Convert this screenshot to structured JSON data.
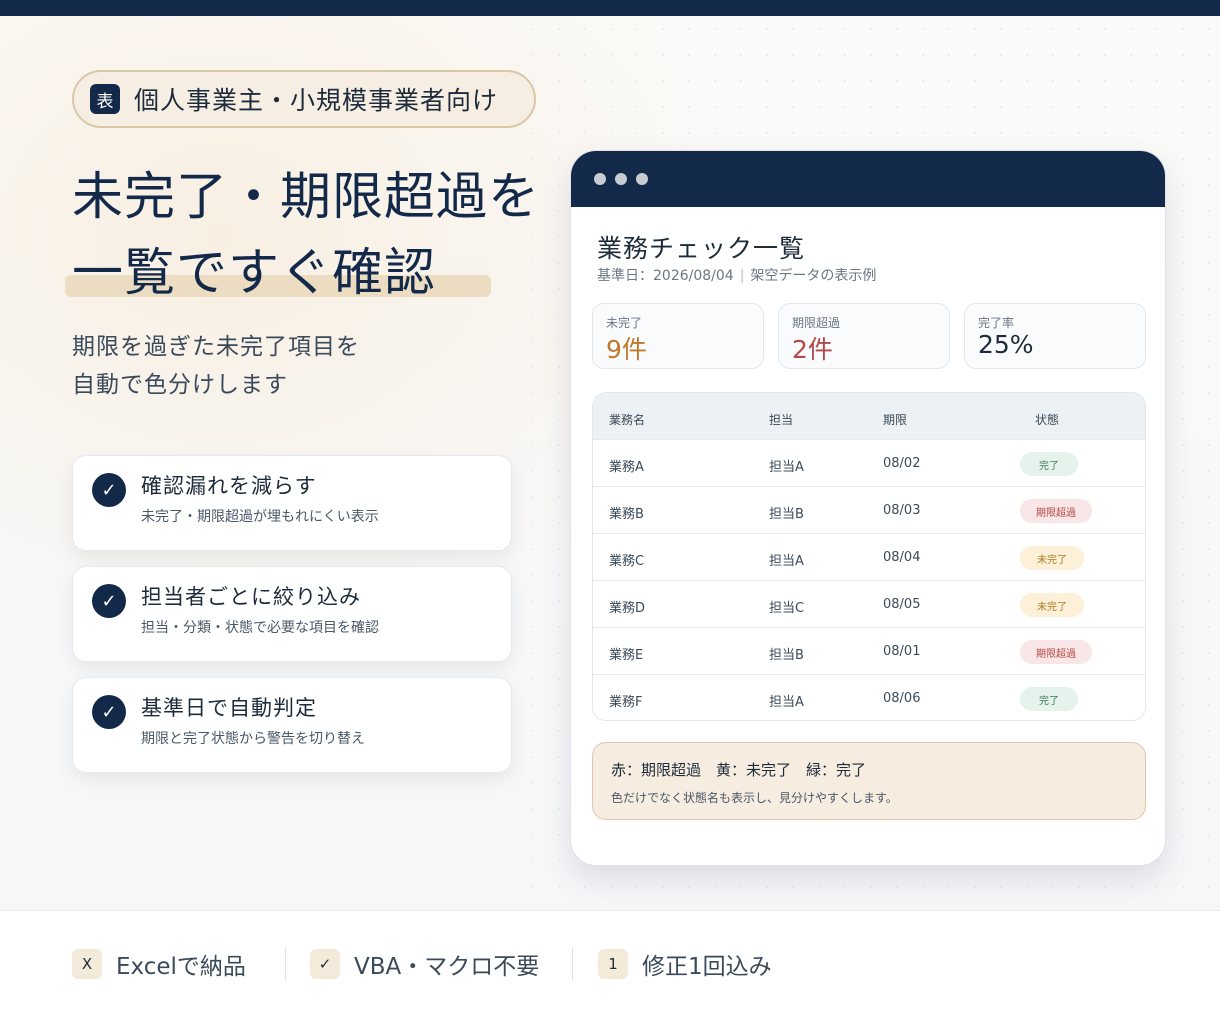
{
  "badge": {
    "icon": "表",
    "text": "個人事業主・小規模事業者向け"
  },
  "headline": {
    "line1": "未完了・期限超過を",
    "line2": "一覧ですぐ確認"
  },
  "subcopy": {
    "line1": "期限を過ぎた未完了項目を",
    "line2": "自動で色分けします"
  },
  "features": [
    {
      "title": "確認漏れを減らす",
      "desc": "未完了・期限超過が埋もれにくい表示"
    },
    {
      "title": "担当者ごとに絞り込み",
      "desc": "担当・分類・状態で必要な項目を確認"
    },
    {
      "title": "基準日で自動判定",
      "desc": "期限と完了状態から警告を切り替え"
    }
  ],
  "check_glyph": "✓",
  "window": {
    "title": "業務チェック一覧",
    "meta_date": "基準日：2026/08/04",
    "meta_sep": "|",
    "meta_note": "架空データの表示例",
    "stats": [
      {
        "label": "未完了",
        "value": "9件",
        "color": "#c07a2c"
      },
      {
        "label": "期限超過",
        "value": "2件",
        "color": "#b24a48"
      },
      {
        "label": "完了率",
        "value": "25%",
        "color": "#1d2b3a"
      }
    ],
    "table": {
      "headers": [
        "業務名",
        "担当",
        "期限",
        "状態"
      ],
      "rows": [
        {
          "name": "業務A",
          "owner": "担当A",
          "due": "08/02",
          "status": "完了"
        },
        {
          "name": "業務B",
          "owner": "担当B",
          "due": "08/03",
          "status": "期限超過"
        },
        {
          "name": "業務C",
          "owner": "担当A",
          "due": "08/04",
          "status": "未完了"
        },
        {
          "name": "業務D",
          "owner": "担当C",
          "due": "08/05",
          "status": "未完了"
        },
        {
          "name": "業務E",
          "owner": "担当B",
          "due": "08/01",
          "status": "期限超過"
        },
        {
          "name": "業務F",
          "owner": "担当A",
          "due": "08/06",
          "status": "完了"
        }
      ]
    },
    "legend": {
      "main": "赤：期限超過　黄：未完了　緑：完了",
      "sub": "色だけでなく状態名も表示し、見分けやすくします。"
    }
  },
  "footer": [
    {
      "icon": "X",
      "label": "Excelで納品"
    },
    {
      "icon": "✓",
      "label": "VBA・マクロ不要"
    },
    {
      "icon": "1",
      "label": "修正1回込み"
    }
  ]
}
